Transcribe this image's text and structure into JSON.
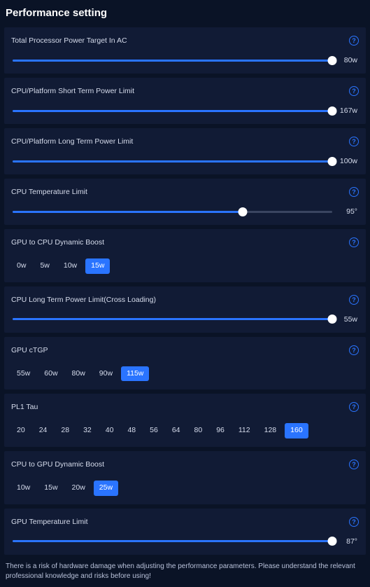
{
  "title": "Performance setting",
  "sliders": [
    {
      "label": "Total Processor Power Target In AC",
      "value": "80w",
      "percent": 100
    },
    {
      "label": "CPU/Platform Short Term Power Limit",
      "value": "167w",
      "percent": 100
    },
    {
      "label": "CPU/Platform Long Term Power Limit",
      "value": "100w",
      "percent": 100
    },
    {
      "label": "CPU Temperature Limit",
      "value": "95°",
      "percent": 72
    },
    {
      "label": "CPU Long Term Power Limit(Cross Loading)",
      "value": "55w",
      "percent": 100
    },
    {
      "label": "GPU Temperature Limit",
      "value": "87°",
      "percent": 100
    }
  ],
  "option_groups": [
    {
      "label": "GPU to CPU Dynamic Boost",
      "options": [
        "0w",
        "5w",
        "10w",
        "15w"
      ],
      "selected": 3
    },
    {
      "label": "GPU cTGP",
      "options": [
        "55w",
        "60w",
        "80w",
        "90w",
        "115w"
      ],
      "selected": 4
    },
    {
      "label": "PL1 Tau",
      "options": [
        "20",
        "24",
        "28",
        "32",
        "40",
        "48",
        "56",
        "64",
        "80",
        "96",
        "112",
        "128",
        "160"
      ],
      "selected": 12
    },
    {
      "label": "CPU to GPU Dynamic Boost",
      "options": [
        "10w",
        "15w",
        "20w",
        "25w"
      ],
      "selected": 3
    }
  ],
  "warning": "There is a risk of hardware damage when adjusting the performance parameters. Please understand the relevant professional knowledge and risks before using!",
  "help_glyph": "?"
}
